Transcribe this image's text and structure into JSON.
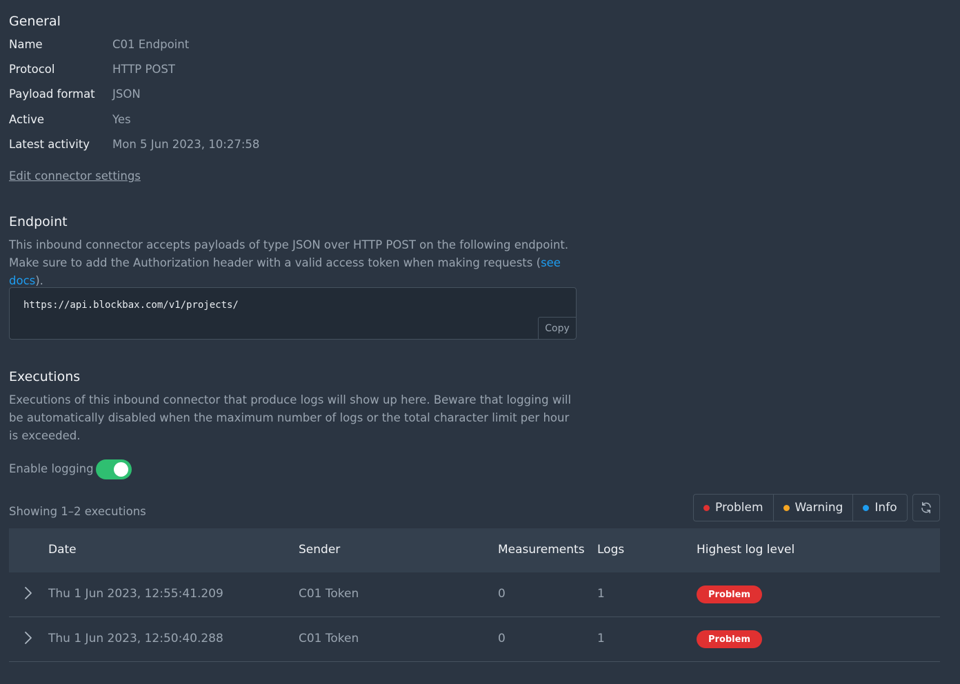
{
  "general": {
    "title": "General",
    "fields": [
      {
        "label": "Name",
        "value": "C01 Endpoint"
      },
      {
        "label": "Protocol",
        "value": "HTTP POST"
      },
      {
        "label": "Payload format",
        "value": "JSON"
      },
      {
        "label": "Active",
        "value": "Yes"
      },
      {
        "label": "Latest activity",
        "value": "Mon 5 Jun 2023, 10:27:58"
      }
    ],
    "edit_link": "Edit connector settings"
  },
  "endpoint": {
    "title": "Endpoint",
    "description_part1": "This inbound connector accepts payloads of type JSON over HTTP POST on the following endpoint. Make sure to add the Authorization header with a valid access token when making requests (",
    "docs_link": "see docs",
    "description_part2": ").",
    "url": "https://api.blockbax.com/v1/projects/",
    "copy_label": "Copy"
  },
  "executions": {
    "title": "Executions",
    "description": "Executions of this inbound connector that produce logs will show up here. Beware that logging will be automatically disabled when the maximum number of logs or the total character limit per hour is exceeded.",
    "logging_label": "Enable logging",
    "logging_enabled": true,
    "showing": "Showing 1–2 executions",
    "filters": [
      {
        "label": "Problem",
        "color": "#e03131"
      },
      {
        "label": "Warning",
        "color": "#f5a623"
      },
      {
        "label": "Info",
        "color": "#1e9df0"
      }
    ],
    "columns": {
      "date": "Date",
      "sender": "Sender",
      "measurements": "Measurements",
      "logs": "Logs",
      "level": "Highest log level"
    },
    "rows": [
      {
        "date": "Thu 1 Jun 2023, 12:55:41.209",
        "sender": "C01 Token",
        "measurements": "0",
        "logs": "1",
        "level": "Problem"
      },
      {
        "date": "Thu 1 Jun 2023, 12:50:40.288",
        "sender": "C01 Token",
        "measurements": "0",
        "logs": "1",
        "level": "Problem"
      }
    ]
  }
}
